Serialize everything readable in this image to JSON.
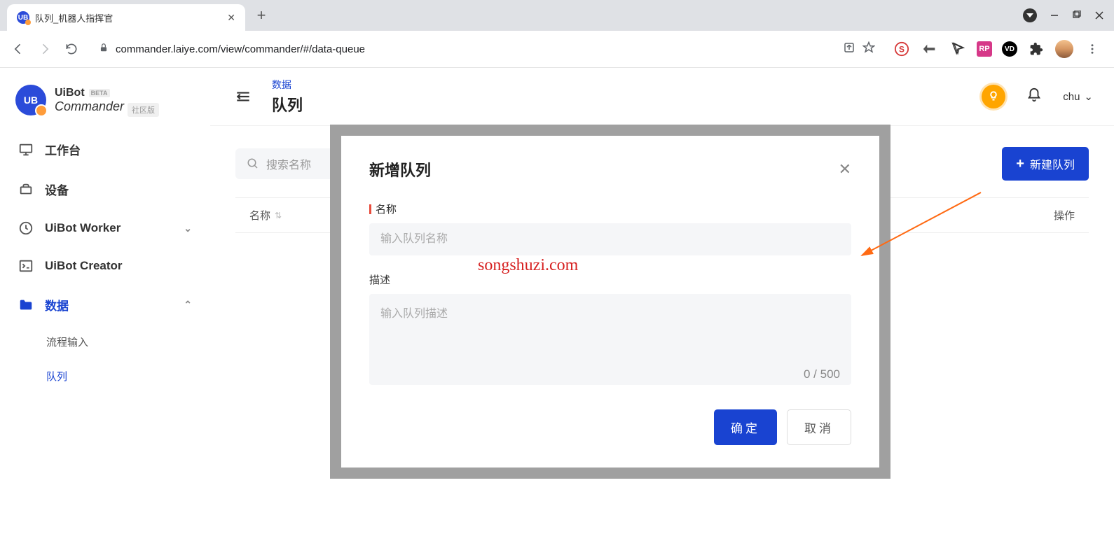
{
  "browser": {
    "tab_title": "队列_机器人指挥官",
    "url": "commander.laiye.com/view/commander/#/data-queue"
  },
  "logo": {
    "brand": "UiBot",
    "beta": "BETA",
    "product": "Commander",
    "badge": "UB",
    "edition": "社区版"
  },
  "sidebar": {
    "items": [
      {
        "label": "工作台"
      },
      {
        "label": "设备"
      },
      {
        "label": "UiBot Worker"
      },
      {
        "label": "UiBot Creator"
      },
      {
        "label": "数据"
      }
    ],
    "sub": [
      {
        "label": "流程输入"
      },
      {
        "label": "队列"
      }
    ]
  },
  "breadcrumb": {
    "parent": "数据",
    "current": "队列"
  },
  "topbar": {
    "user": "chu"
  },
  "toolbar": {
    "search_placeholder": "搜索名称",
    "new_btn": "新建队列"
  },
  "table": {
    "col_name": "名称",
    "col_op": "操作"
  },
  "modal": {
    "title": "新增队列",
    "label_name": "名称",
    "placeholder_name": "输入队列名称",
    "label_desc": "描述",
    "placeholder_desc": "输入队列描述",
    "char_count": "0 / 500",
    "ok": "确定",
    "cancel": "取消"
  },
  "watermark": "songshuzi.com"
}
